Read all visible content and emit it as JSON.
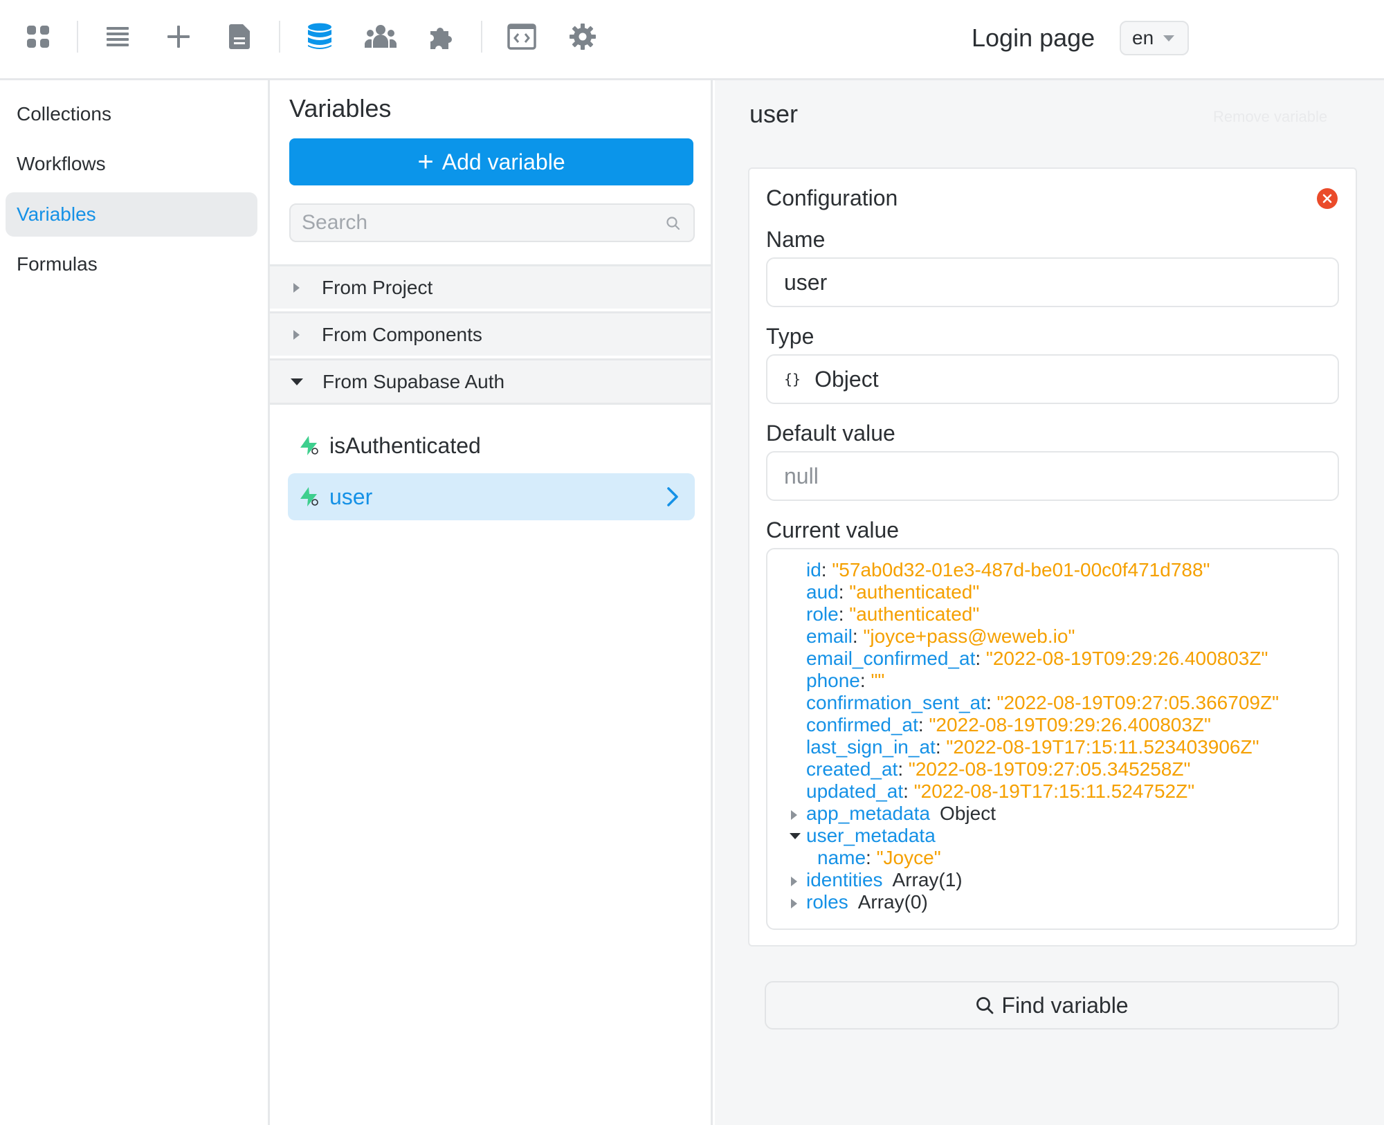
{
  "toolbar": {
    "icons": [
      "apps-icon",
      "layers-icon",
      "add-icon",
      "page-icon",
      "database-icon",
      "users-icon",
      "plugins-icon",
      "code-icon",
      "settings-icon"
    ],
    "active_icon": "database-icon",
    "page_title": "Login page",
    "language": "en"
  },
  "sidebar": {
    "items": [
      {
        "label": "Collections"
      },
      {
        "label": "Workflows"
      },
      {
        "label": "Variables",
        "active": true
      },
      {
        "label": "Formulas"
      }
    ]
  },
  "variables_panel": {
    "title": "Variables",
    "add_button": "Add variable",
    "search_placeholder": "Search",
    "groups": [
      {
        "label": "From Project",
        "expanded": false
      },
      {
        "label": "From Components",
        "expanded": false
      },
      {
        "label": "From Supabase Auth",
        "expanded": true
      }
    ],
    "items": [
      {
        "label": "isAuthenticated",
        "active": false
      },
      {
        "label": "user",
        "active": true
      }
    ]
  },
  "detail": {
    "title": "user",
    "remove_label": "Remove variable",
    "card_title": "Configuration",
    "name_label": "Name",
    "name_value": "user",
    "type_label": "Type",
    "type_icon": "{}",
    "type_value": "Object",
    "default_label": "Default value",
    "default_value": "null",
    "current_label": "Current value",
    "current_value": [
      {
        "key": "id",
        "value": "\"57ab0d32-01e3-487d-be01-00c0f471d788\""
      },
      {
        "key": "aud",
        "value": "\"authenticated\""
      },
      {
        "key": "role",
        "value": "\"authenticated\""
      },
      {
        "key": "email",
        "value": "\"joyce+pass@weweb.io\""
      },
      {
        "key": "email_confirmed_at",
        "value": "\"2022-08-19T09:29:26.400803Z\""
      },
      {
        "key": "phone",
        "value": "\"\""
      },
      {
        "key": "confirmation_sent_at",
        "value": "\"2022-08-19T09:27:05.366709Z\""
      },
      {
        "key": "confirmed_at",
        "value": "\"2022-08-19T09:29:26.400803Z\""
      },
      {
        "key": "last_sign_in_at",
        "value": "\"2022-08-19T17:15:11.523403906Z\""
      },
      {
        "key": "created_at",
        "value": "\"2022-08-19T09:27:05.345258Z\""
      },
      {
        "key": "updated_at",
        "value": "\"2022-08-19T17:15:11.524752Z\""
      },
      {
        "key": "app_metadata",
        "type": "Object",
        "expanded": false
      },
      {
        "key": "user_metadata",
        "expanded": true
      },
      {
        "key": "name",
        "value": "\"Joyce\"",
        "nested": true
      },
      {
        "key": "identities",
        "type": "Array(1)",
        "expanded": false
      },
      {
        "key": "roles",
        "type": "Array(0)",
        "expanded": false
      }
    ],
    "find_button": "Find variable"
  },
  "colors": {
    "accent": "#0b95ea",
    "key": "#1591e6",
    "string_value": "#f5a000",
    "close": "#ea4b2a",
    "variable_icon": "#3ecf8e"
  }
}
